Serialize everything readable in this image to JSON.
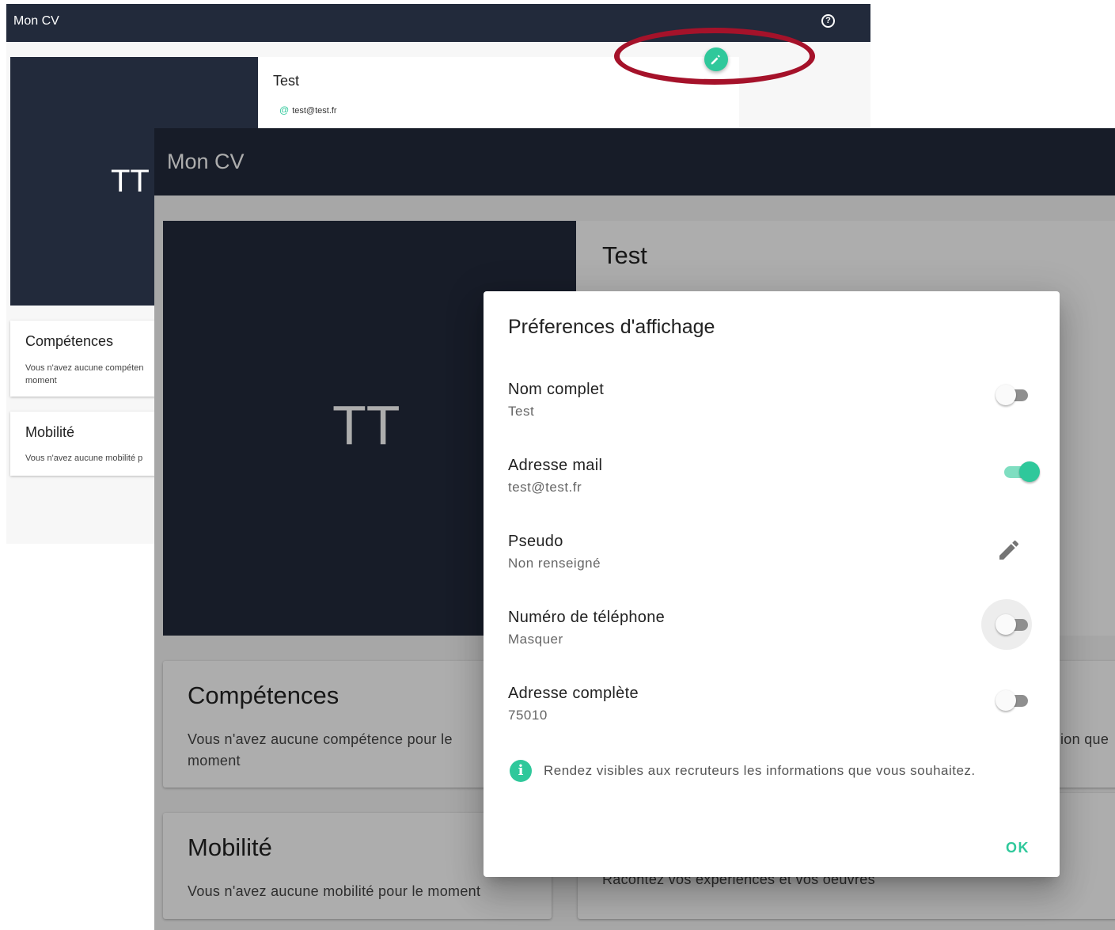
{
  "background_screenshot": {
    "app_title": "Mon CV",
    "help_icon": "help-circle-icon",
    "avatar_initials": "TT",
    "profile": {
      "name": "Test",
      "email": "test@test.fr",
      "email_icon": "at-icon"
    },
    "edit_fab_icon": "pencil-icon",
    "cards": {
      "competences": {
        "title": "Compétences",
        "text_line1": "Vous n'avez aucune compéten",
        "text_line2": "moment"
      },
      "mobilite": {
        "title": "Mobilité",
        "text": "Vous n'avez aucune mobilité p"
      }
    },
    "highlight_color": "#a5122a"
  },
  "foreground_screenshot": {
    "app_title": "Mon CV",
    "avatar_initials": "TT",
    "profile": {
      "name": "Test"
    },
    "cards": {
      "competences": {
        "title": "Compétences",
        "text_line1": "Vous n'avez aucune compétence pour le",
        "text_line2": "moment"
      },
      "mobilite": {
        "title": "Mobilité",
        "text": "Vous n'avez aucune mobilité pour le moment"
      },
      "partial_right_text": "ion que",
      "experiences_text": "Racontez vos expériences et vos oeuvres"
    }
  },
  "dialog": {
    "title": "Préferences d'affichage",
    "preferences": [
      {
        "label": "Nom complet",
        "value": "Test",
        "control": "toggle",
        "on": false
      },
      {
        "label": "Adresse mail",
        "value": "test@test.fr",
        "control": "toggle",
        "on": true
      },
      {
        "label": "Pseudo",
        "value": "Non renseigné",
        "control": "edit",
        "icon": "pencil-icon"
      },
      {
        "label": "Numéro de téléphone",
        "value": "Masquer",
        "control": "toggle",
        "on": false,
        "focused": true
      },
      {
        "label": "Adresse complète",
        "value": "75010",
        "control": "toggle",
        "on": false
      }
    ],
    "info_icon": "info-icon",
    "info_text": "Rendez visibles aux recruteurs les informations que vous souhaitez.",
    "ok_label": "OK"
  },
  "colors": {
    "accent": "#2fc89b",
    "appbar": "#222a3b",
    "highlight": "#a5122a"
  }
}
